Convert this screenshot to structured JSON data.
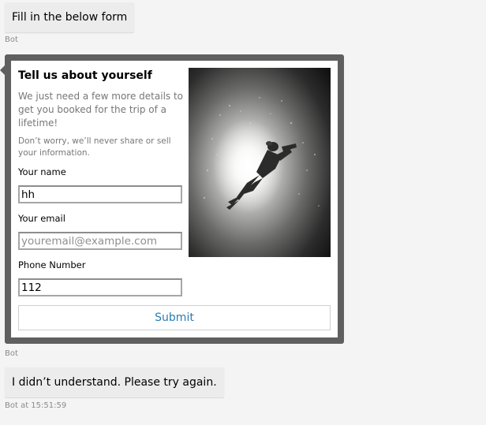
{
  "messages": [
    {
      "text": "Fill in the below form",
      "meta": "Bot"
    },
    {
      "meta": "Bot"
    },
    {
      "text": "I didn’t understand. Please try again.",
      "meta": "Bot at 15:51:59"
    }
  ],
  "card": {
    "title": "Tell us about yourself",
    "intro": "We just need a few more details to get you booked for the trip of a lifetime!",
    "note": "Don’t worry, we’ll never share or sell your information.",
    "image": "scuba-diver-silhouette-underwater",
    "fields": {
      "name": {
        "label": "Your name",
        "value": "hh",
        "placeholder": ""
      },
      "email": {
        "label": "Your email",
        "value": "",
        "placeholder": "youremail@example.com"
      },
      "phone": {
        "label": "Phone Number",
        "value": "112",
        "placeholder": ""
      }
    },
    "submit_label": "Submit"
  },
  "colors": {
    "background": "#f4f4f4",
    "bubble": "#ececec",
    "card_frame": "#5f5f5f",
    "link_accent": "#2a7bb3",
    "meta_text": "#8a8a8a"
  }
}
